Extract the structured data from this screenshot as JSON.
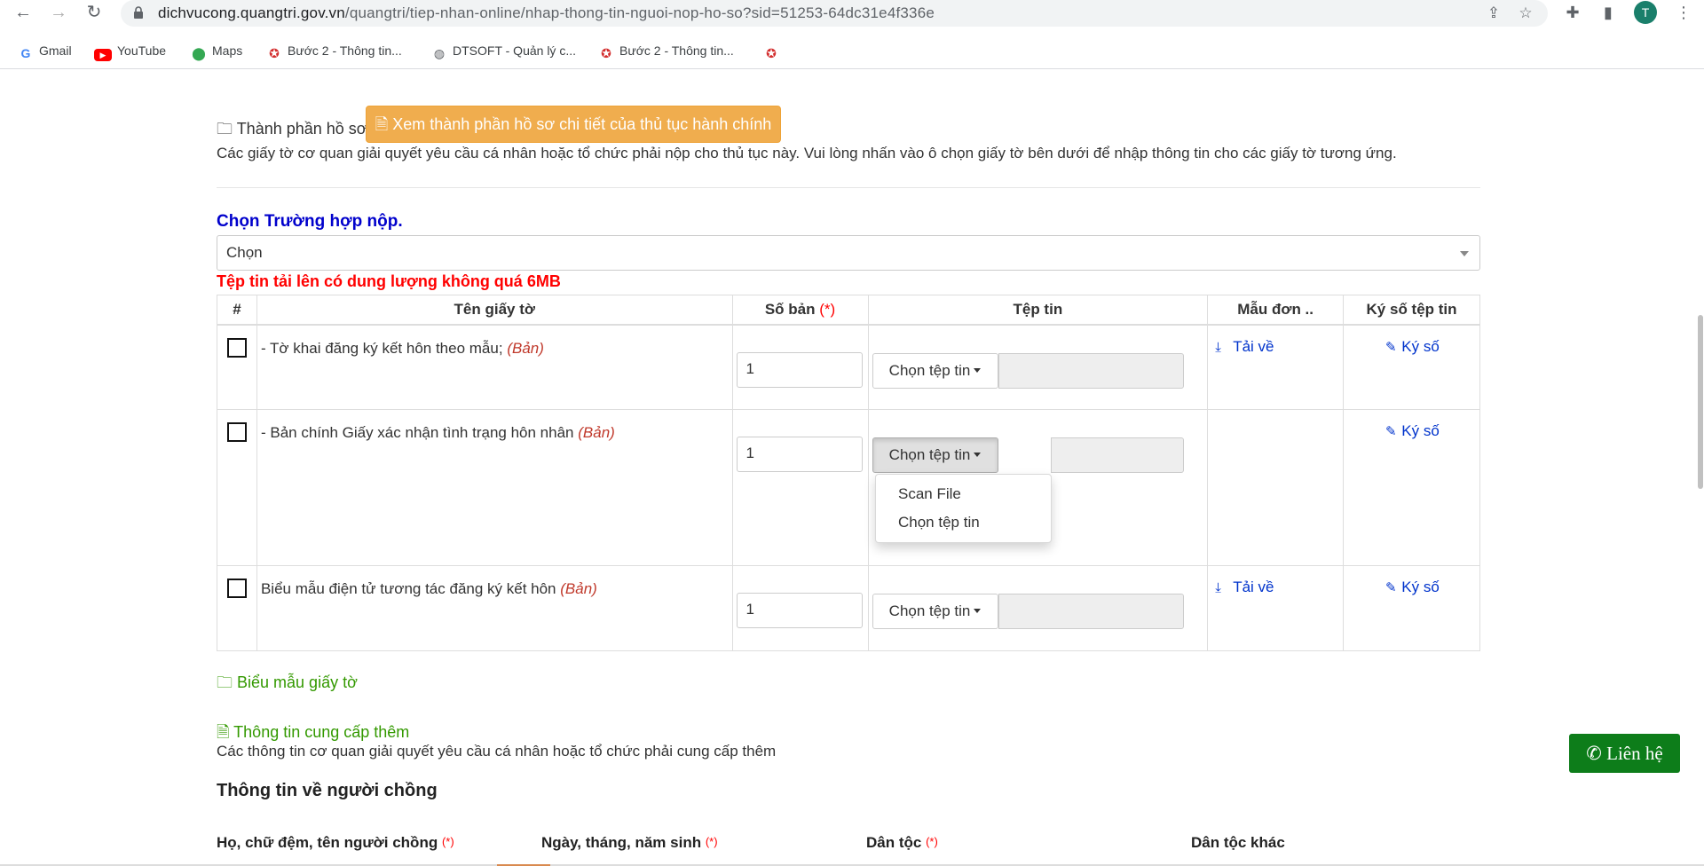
{
  "browser": {
    "url_domain": "dichvucong.quangtri.gov.vn",
    "url_path": "/quangtri/tiep-nhan-online/nhap-thong-tin-nguoi-nop-ho-so?sid=51253-64dc31e4f336e",
    "profile_initial": "T",
    "bookmarks": [
      {
        "label": "Gmail",
        "icon": "gmail-icon"
      },
      {
        "label": "YouTube",
        "icon": "youtube-icon"
      },
      {
        "label": "Maps",
        "icon": "maps-icon"
      },
      {
        "label": "Bước 2 - Thông tin...",
        "icon": "emblem-icon"
      },
      {
        "label": "DTSOFT - Quản lý c...",
        "icon": "globe-icon"
      },
      {
        "label": "Bước 2 - Thông tin...",
        "icon": "emblem-icon"
      }
    ]
  },
  "dossier": {
    "heading": "Thành phần hồ sơ",
    "detail_button": "Xem thành phần hồ sơ chi tiết của thủ tục hành chính",
    "description": "Các giấy tờ cơ quan giải quyết yêu cầu cá nhân hoặc tổ chức phải nộp cho thủ tục này. Vui lòng nhấn vào ô chọn giấy tờ bên dưới để nhập thông tin cho các giấy tờ tương ứng."
  },
  "case": {
    "label": "Chọn Trường hợp nộp.",
    "selected": "Chọn",
    "size_warning": "Tệp tin tải lên có dung lượng không quá 6MB"
  },
  "table": {
    "headers": {
      "num": "#",
      "name": "Tên giấy tờ",
      "copies": "Số bản",
      "copies_req": "(*)",
      "file": "Tệp tin",
      "template": "Mẫu đơn ..",
      "sign": "Ký số tệp tin"
    },
    "rows": [
      {
        "name": "- Tờ khai đăng ký kết hôn theo mẫu;",
        "unit": "(Bản)",
        "copies": "1",
        "file_button": "Chọn tệp tin",
        "download": "Tải về",
        "sign": "Ký số"
      },
      {
        "name": "- Bản chính Giấy xác nhận tình trạng hôn nhân",
        "unit": "(Bản)",
        "copies": "1",
        "file_button": "Chọn tệp tin",
        "download": "",
        "sign": "Ký số"
      },
      {
        "name": "Biểu mẫu điện tử tương tác đăng ký kết hôn",
        "unit": "(Bản)",
        "copies": "1",
        "file_button": "Chọn tệp tin",
        "download": "Tải về",
        "sign": "Ký số"
      }
    ],
    "dropdown_items": [
      "Scan File",
      "Chọn tệp tin"
    ]
  },
  "forms_link": "Biểu mẫu giấy tờ",
  "extra": {
    "link": "Thông tin cung cấp thêm",
    "description": "Các thông tin cơ quan giải quyết yêu cầu cá nhân hoặc tổ chức phải cung cấp thêm"
  },
  "husband": {
    "heading": "Thông tin về người chồng",
    "fields": [
      {
        "label": "Họ, chữ đệm, tên người chồng",
        "req": "(*)"
      },
      {
        "label": "Ngày, tháng, năm sinh",
        "req": "(*)"
      },
      {
        "label": "Dân tộc",
        "req": "(*)"
      },
      {
        "label": "Dân tộc khác",
        "req": ""
      }
    ]
  },
  "contact_button": "Liên hệ"
}
